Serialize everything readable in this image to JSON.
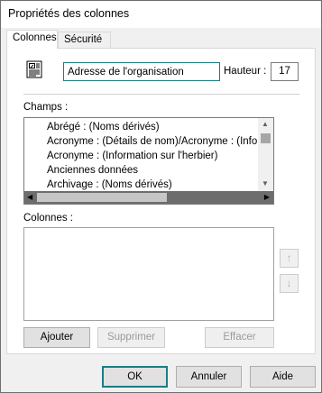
{
  "window": {
    "title": "Propriétés des colonnes"
  },
  "tabs": [
    {
      "label": "Colonnes"
    },
    {
      "label": "Sécurité"
    }
  ],
  "header": {
    "name_value": "Adresse de l'organisation",
    "height_label": "Hauteur :",
    "height_value": "17"
  },
  "champs": {
    "label": "Champs :",
    "items": [
      "Abrégé : (Noms dérivés)",
      "Acronyme : (Détails de nom)/Acronyme : (Inform",
      "Acronyme : (Information sur l'herbier)",
      "Anciennes données",
      "Archivage : (Noms dérivés)"
    ]
  },
  "colonnes": {
    "label": "Colonnes :"
  },
  "actions": {
    "add": "Ajouter",
    "delete": "Supprimer",
    "clear": "Effacer"
  },
  "footer": {
    "ok": "OK",
    "cancel": "Annuler",
    "help": "Aide"
  },
  "colors": {
    "accent": "#1a7d84",
    "hscroll_track": "#6d6d6d"
  }
}
